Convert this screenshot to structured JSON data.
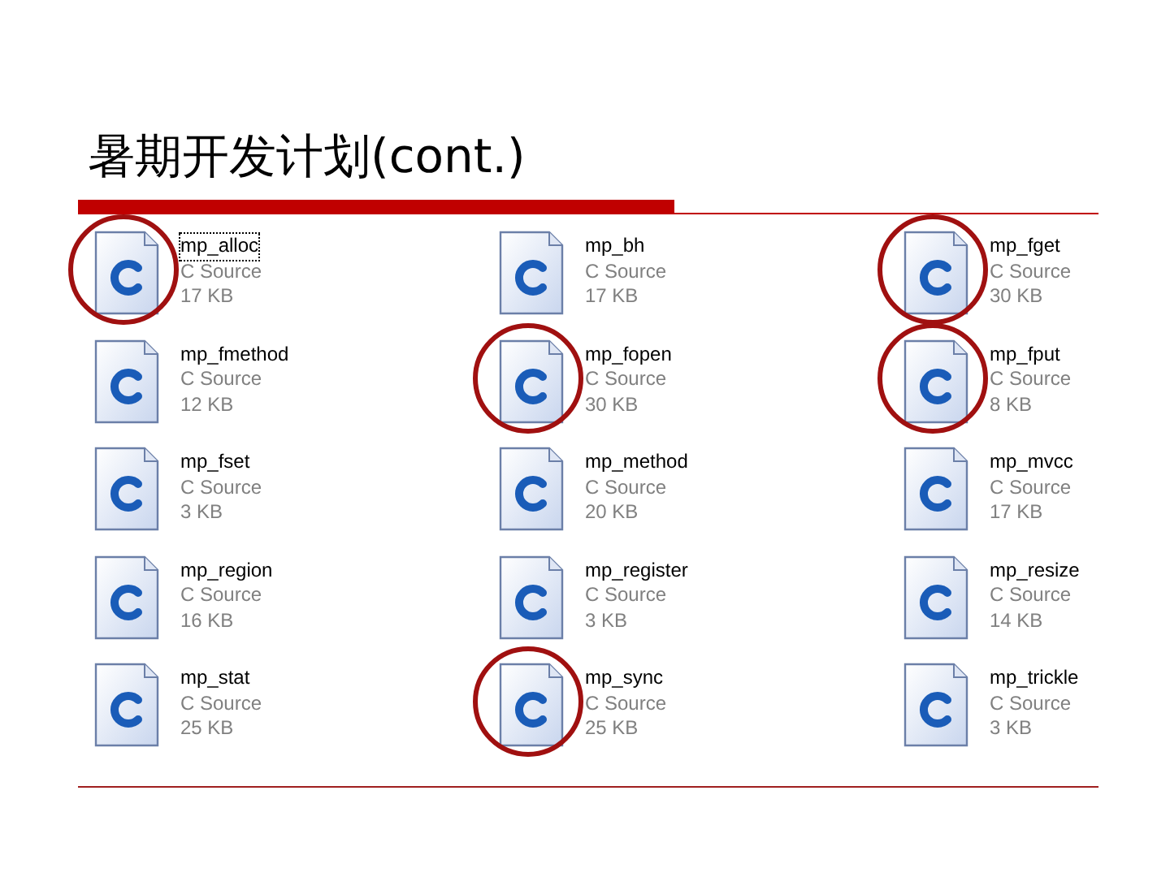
{
  "slide": {
    "title": "暑期开发计划(cont.)"
  },
  "files": [
    {
      "name": "mp_alloc",
      "type": "C Source",
      "size": "17 KB",
      "circled": true,
      "focused": true
    },
    {
      "name": "mp_bh",
      "type": "C Source",
      "size": "17 KB",
      "circled": false,
      "focused": false
    },
    {
      "name": "mp_fget",
      "type": "C Source",
      "size": "30 KB",
      "circled": true,
      "focused": false
    },
    {
      "name": "mp_fmethod",
      "type": "C Source",
      "size": "12 KB",
      "circled": false,
      "focused": false
    },
    {
      "name": "mp_fopen",
      "type": "C Source",
      "size": "30 KB",
      "circled": true,
      "focused": false
    },
    {
      "name": "mp_fput",
      "type": "C Source",
      "size": "8 KB",
      "circled": true,
      "focused": false
    },
    {
      "name": "mp_fset",
      "type": "C Source",
      "size": "3 KB",
      "circled": false,
      "focused": false
    },
    {
      "name": "mp_method",
      "type": "C Source",
      "size": "20 KB",
      "circled": false,
      "focused": false
    },
    {
      "name": "mp_mvcc",
      "type": "C Source",
      "size": "17 KB",
      "circled": false,
      "focused": false
    },
    {
      "name": "mp_region",
      "type": "C Source",
      "size": "16 KB",
      "circled": false,
      "focused": false
    },
    {
      "name": "mp_register",
      "type": "C Source",
      "size": "3 KB",
      "circled": false,
      "focused": false
    },
    {
      "name": "mp_resize",
      "type": "C Source",
      "size": "14 KB",
      "circled": false,
      "focused": false
    },
    {
      "name": "mp_stat",
      "type": "C Source",
      "size": "25 KB",
      "circled": false,
      "focused": false
    },
    {
      "name": "mp_sync",
      "type": "C Source",
      "size": "25 KB",
      "circled": true,
      "focused": false
    },
    {
      "name": "mp_trickle",
      "type": "C Source",
      "size": "3 KB",
      "circled": false,
      "focused": false
    }
  ]
}
